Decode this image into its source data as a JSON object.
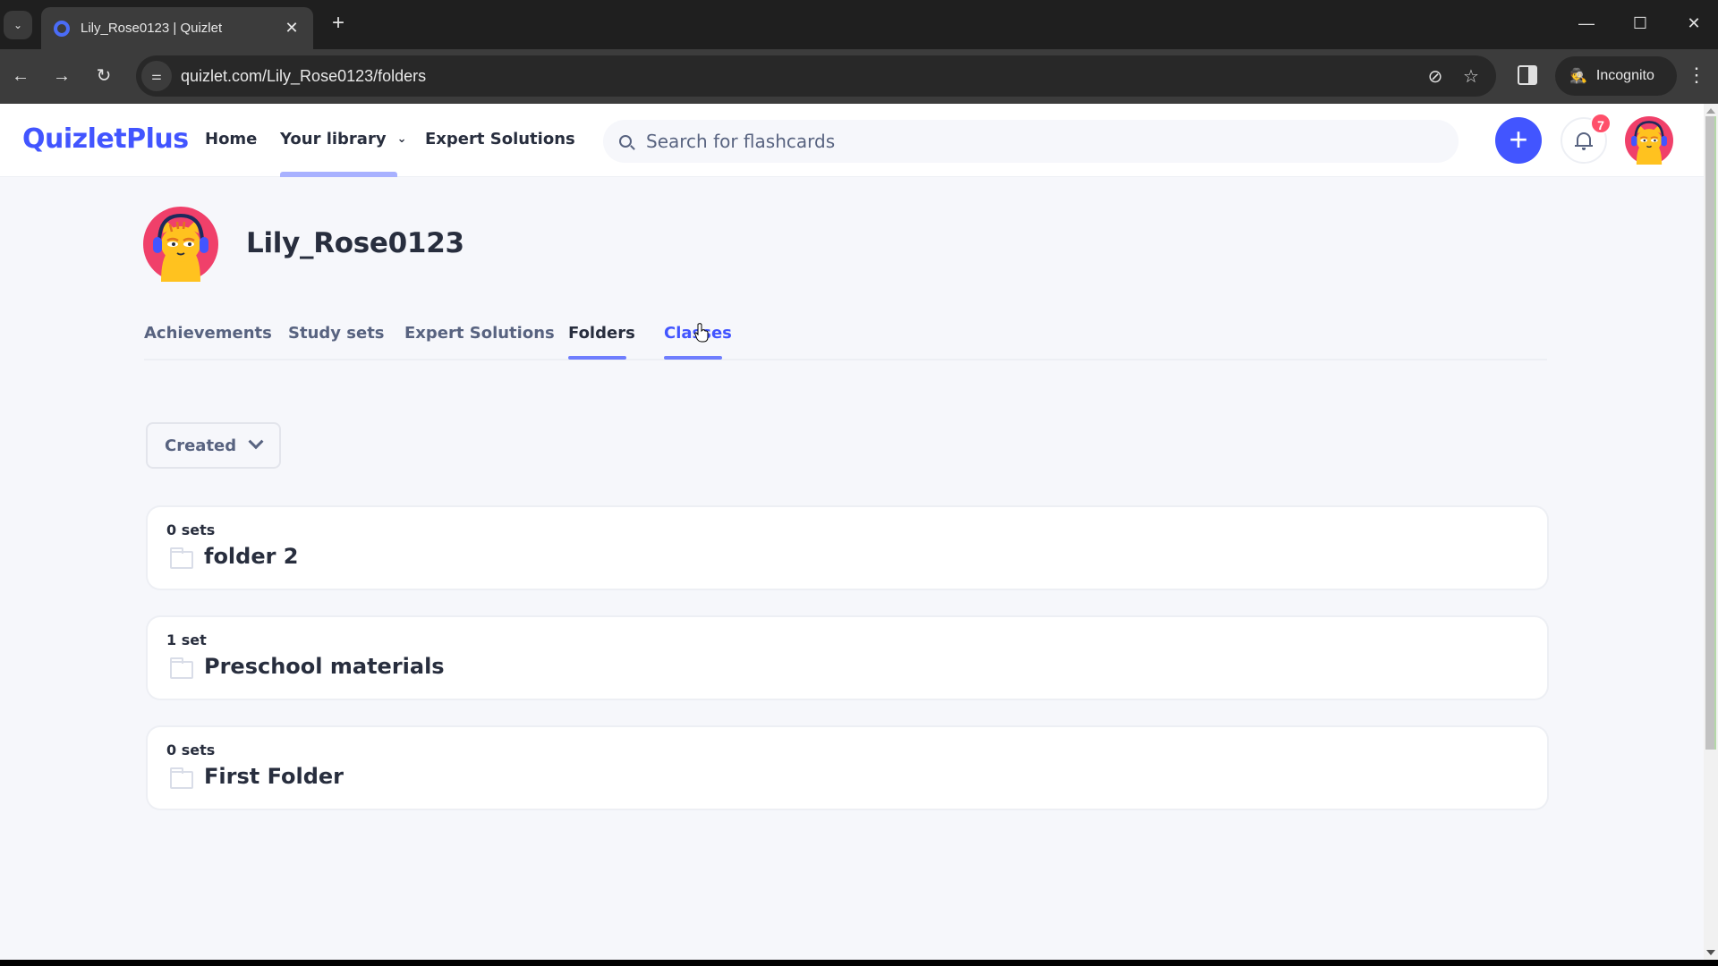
{
  "browser": {
    "tab_title": "Lily_Rose0123 | Quizlet",
    "url": "quizlet.com/Lily_Rose0123/folders",
    "incognito_label": "Incognito",
    "icons": {
      "tab_search": "chevron-down-icon",
      "new_tab": "plus-icon",
      "back": "arrow-left-icon",
      "forward": "arrow-right-icon",
      "reload": "reload-icon",
      "site_info": "tune-icon",
      "tracking": "eye-off-icon",
      "bookmark": "star-icon",
      "side_panel": "side-panel-icon",
      "menu": "kebab-menu-icon"
    },
    "glyphs": {
      "chev": "⌄",
      "close": "✕",
      "plus": "+",
      "back": "←",
      "forward": "→",
      "reload": "↻",
      "site_info": "⚌",
      "eye_off": "⊘",
      "star": "☆",
      "incognito": "🕵",
      "menu": "⋮",
      "minimize": "—",
      "maximize": "☐",
      "win_close": "✕"
    }
  },
  "header": {
    "logo": "QuizletPlus",
    "nav": [
      {
        "label": "Home"
      },
      {
        "label": "Your library",
        "has_dropdown": true,
        "active": true
      },
      {
        "label": "Expert Solutions"
      }
    ],
    "nav_chevron": "⌄",
    "search_placeholder": "Search for flashcards",
    "create_label": "+",
    "notification_count": "7",
    "brand_color": "#4255ff",
    "badge_color": "#ff4f6a"
  },
  "profile": {
    "username": "Lily_Rose0123",
    "avatar": "cat-with-headphones-avatar"
  },
  "tabs": [
    {
      "label": "Achievements"
    },
    {
      "label": "Study sets"
    },
    {
      "label": "Expert Solutions"
    },
    {
      "label": "Folders",
      "active": true
    },
    {
      "label": "Classes",
      "hover": true
    }
  ],
  "filter": {
    "selected": "Created"
  },
  "folders": [
    {
      "count": "0 sets",
      "name": "folder 2"
    },
    {
      "count": "1 set",
      "name": "Preschool materials"
    },
    {
      "count": "0 sets",
      "name": "First Folder"
    }
  ]
}
